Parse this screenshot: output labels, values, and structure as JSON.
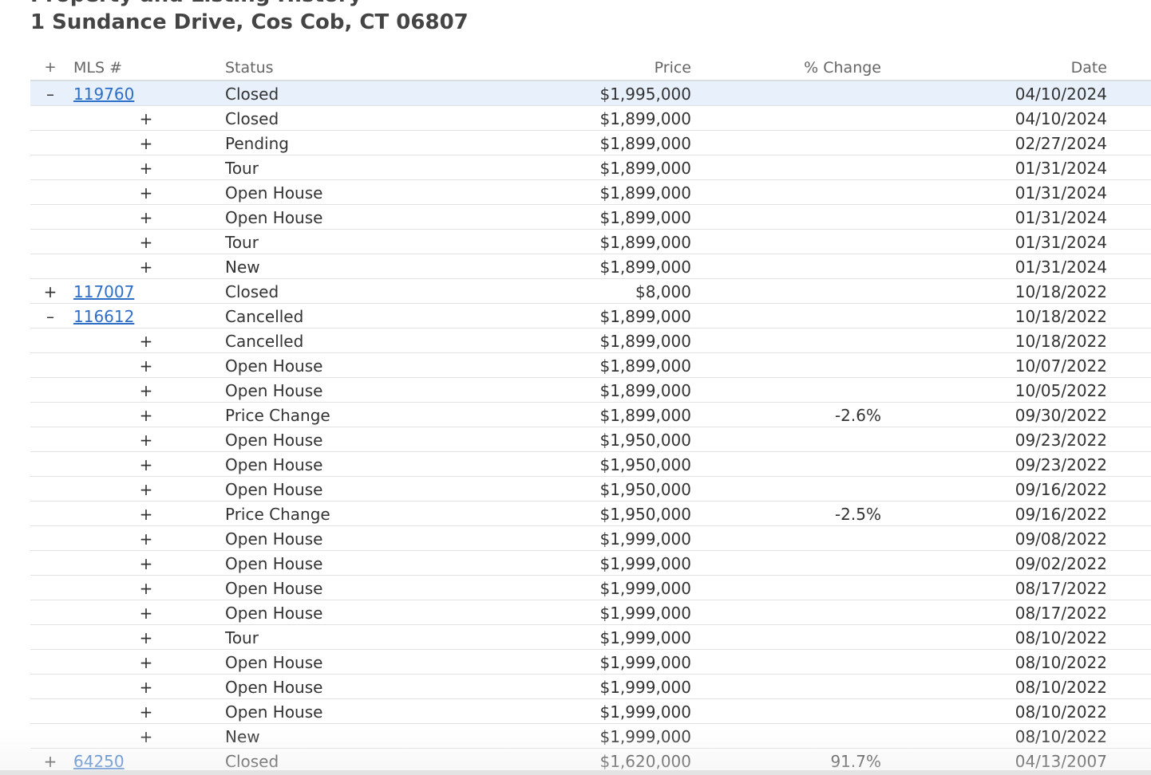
{
  "page": {
    "title": "Property and Listing History",
    "address": "1 Sundance Drive, Cos Cob, CT 06807"
  },
  "table": {
    "headers": {
      "toggle": "+",
      "mls": "MLS #",
      "status": "Status",
      "price": "Price",
      "change": "% Change",
      "date": "Date"
    },
    "rows": [
      {
        "type": "listing",
        "toggle": "–",
        "mls": "119760",
        "status": "Closed",
        "price": "$1,995,000",
        "change": "",
        "date": "04/10/2024",
        "highlight": true
      },
      {
        "type": "event",
        "toggle": "+",
        "status": "Closed",
        "price": "$1,899,000",
        "change": "",
        "date": "04/10/2024"
      },
      {
        "type": "event",
        "toggle": "+",
        "status": "Pending",
        "price": "$1,899,000",
        "change": "",
        "date": "02/27/2024"
      },
      {
        "type": "event",
        "toggle": "+",
        "status": "Tour",
        "price": "$1,899,000",
        "change": "",
        "date": "01/31/2024"
      },
      {
        "type": "event",
        "toggle": "+",
        "status": "Open House",
        "price": "$1,899,000",
        "change": "",
        "date": "01/31/2024"
      },
      {
        "type": "event",
        "toggle": "+",
        "status": "Open House",
        "price": "$1,899,000",
        "change": "",
        "date": "01/31/2024"
      },
      {
        "type": "event",
        "toggle": "+",
        "status": "Tour",
        "price": "$1,899,000",
        "change": "",
        "date": "01/31/2024"
      },
      {
        "type": "event",
        "toggle": "+",
        "status": "New",
        "price": "$1,899,000",
        "change": "",
        "date": "01/31/2024"
      },
      {
        "type": "listing",
        "toggle": "+",
        "mls": "117007",
        "status": "Closed",
        "price": "$8,000",
        "change": "",
        "date": "10/18/2022"
      },
      {
        "type": "listing",
        "toggle": "–",
        "mls": "116612",
        "status": "Cancelled",
        "price": "$1,899,000",
        "change": "",
        "date": "10/18/2022"
      },
      {
        "type": "event",
        "toggle": "+",
        "status": "Cancelled",
        "price": "$1,899,000",
        "change": "",
        "date": "10/18/2022"
      },
      {
        "type": "event",
        "toggle": "+",
        "status": "Open House",
        "price": "$1,899,000",
        "change": "",
        "date": "10/07/2022"
      },
      {
        "type": "event",
        "toggle": "+",
        "status": "Open House",
        "price": "$1,899,000",
        "change": "",
        "date": "10/05/2022"
      },
      {
        "type": "event",
        "toggle": "+",
        "status": "Price Change",
        "price": "$1,899,000",
        "change": "-2.6%",
        "date": "09/30/2022"
      },
      {
        "type": "event",
        "toggle": "+",
        "status": "Open House",
        "price": "$1,950,000",
        "change": "",
        "date": "09/23/2022"
      },
      {
        "type": "event",
        "toggle": "+",
        "status": "Open House",
        "price": "$1,950,000",
        "change": "",
        "date": "09/23/2022"
      },
      {
        "type": "event",
        "toggle": "+",
        "status": "Open House",
        "price": "$1,950,000",
        "change": "",
        "date": "09/16/2022"
      },
      {
        "type": "event",
        "toggle": "+",
        "status": "Price Change",
        "price": "$1,950,000",
        "change": "-2.5%",
        "date": "09/16/2022"
      },
      {
        "type": "event",
        "toggle": "+",
        "status": "Open House",
        "price": "$1,999,000",
        "change": "",
        "date": "09/08/2022"
      },
      {
        "type": "event",
        "toggle": "+",
        "status": "Open House",
        "price": "$1,999,000",
        "change": "",
        "date": "09/02/2022"
      },
      {
        "type": "event",
        "toggle": "+",
        "status": "Open House",
        "price": "$1,999,000",
        "change": "",
        "date": "08/17/2022"
      },
      {
        "type": "event",
        "toggle": "+",
        "status": "Open House",
        "price": "$1,999,000",
        "change": "",
        "date": "08/17/2022"
      },
      {
        "type": "event",
        "toggle": "+",
        "status": "Tour",
        "price": "$1,999,000",
        "change": "",
        "date": "08/10/2022"
      },
      {
        "type": "event",
        "toggle": "+",
        "status": "Open House",
        "price": "$1,999,000",
        "change": "",
        "date": "08/10/2022"
      },
      {
        "type": "event",
        "toggle": "+",
        "status": "Open House",
        "price": "$1,999,000",
        "change": "",
        "date": "08/10/2022"
      },
      {
        "type": "event",
        "toggle": "+",
        "status": "Open House",
        "price": "$1,999,000",
        "change": "",
        "date": "08/10/2022"
      },
      {
        "type": "event",
        "toggle": "+",
        "status": "New",
        "price": "$1,999,000",
        "change": "",
        "date": "08/10/2022"
      },
      {
        "type": "listing",
        "toggle": "+",
        "mls": "64250",
        "status": "Closed",
        "price": "$1,620,000",
        "change": "91.7%",
        "date": "04/13/2007"
      }
    ]
  },
  "colors": {
    "link": "#2d6fc7",
    "highlight_row": "#e8f1fb",
    "row_border": "#e1e1e1"
  }
}
